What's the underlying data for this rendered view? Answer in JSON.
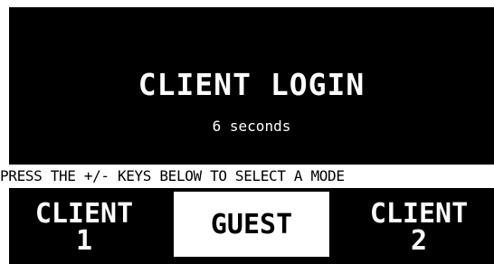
{
  "title": "CLIENT LOGIN",
  "countdown": "6 seconds",
  "instruction": "PRESS THE +/- KEYS BELOW TO SELECT A MODE",
  "modes": [
    {
      "line1": "CLIENT",
      "line2": "1",
      "selected": false
    },
    {
      "line1": "GUEST",
      "line2": "",
      "selected": true
    },
    {
      "line1": "CLIENT",
      "line2": "2",
      "selected": false
    }
  ],
  "colors": {
    "background": "#000000",
    "foreground": "#ffffff"
  }
}
